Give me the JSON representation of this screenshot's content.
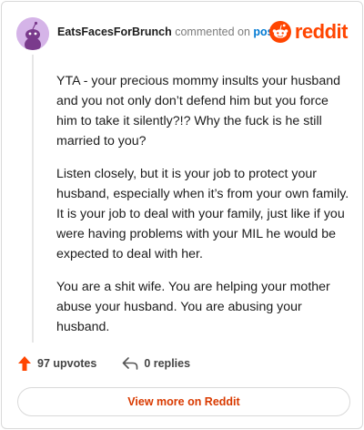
{
  "header": {
    "username": "EatsFacesForBrunch",
    "commented_on": "commented on",
    "post_link": "post",
    "logo_text": "reddit"
  },
  "comment": {
    "paragraphs": [
      "YTA - your precious mommy insults your husband and you not only don’t defend him but you force him to take it silently?!? Why the fuck is he still married to you?",
      "Listen closely, but it is your job to protect your husband, especially when it’s from your own family. It is your job to deal with your family, just like if you were having problems with your MIL he would be expected to deal with her.",
      "You are a shit wife. You are helping your mother abuse your husband. You are abusing your husband."
    ]
  },
  "actions": {
    "upvotes": "97 upvotes",
    "replies": "0 replies"
  },
  "view_more": "View more on Reddit",
  "colors": {
    "brand": "#ff4500",
    "link": "#0079d3",
    "view_more": "#d93a00"
  }
}
